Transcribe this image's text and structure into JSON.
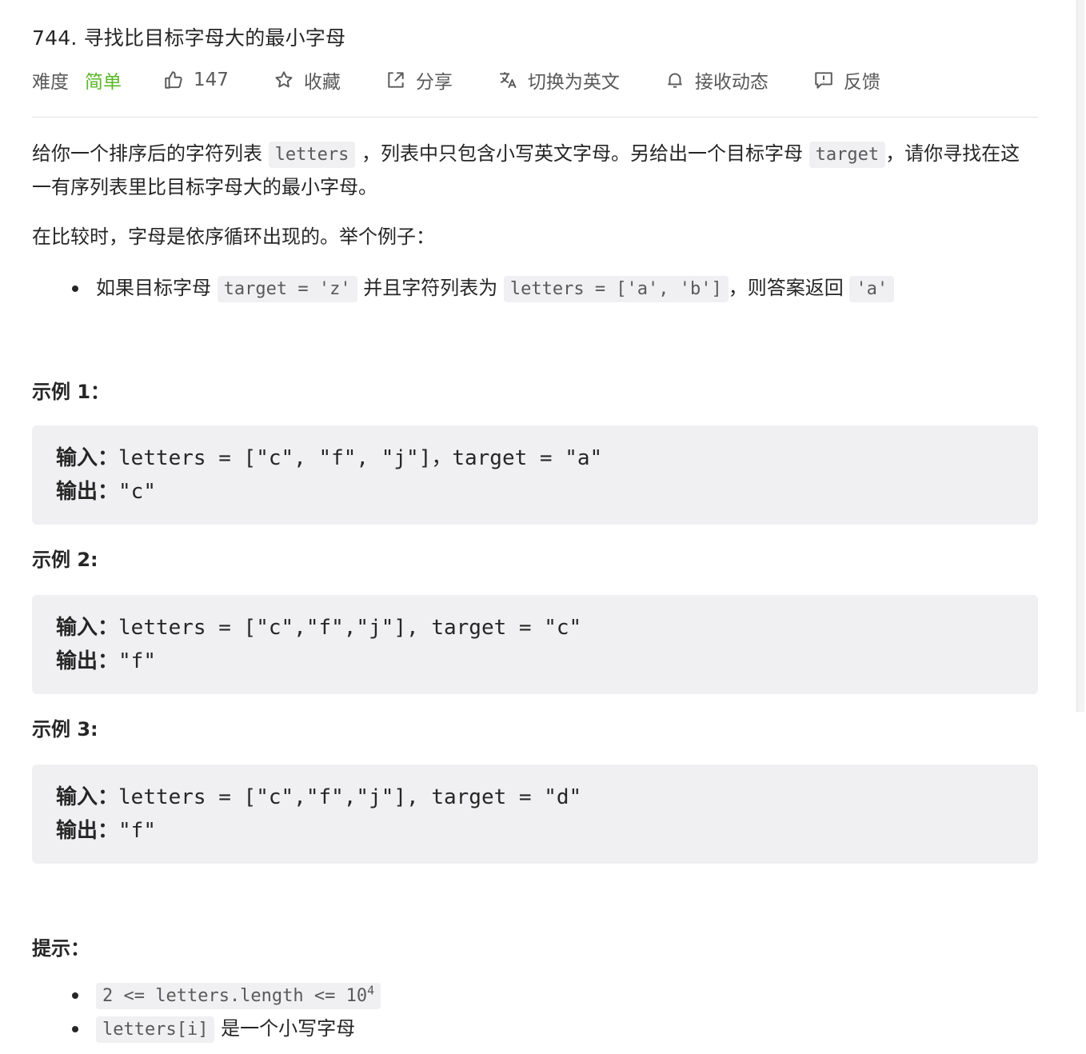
{
  "problem": {
    "title": "744. 寻找比目标字母大的最小字母",
    "difficulty_label": "难度",
    "difficulty_value": "简单",
    "likes": "147",
    "favorite": "收藏",
    "share": "分享",
    "switch_lang": "切换为英文",
    "subscribe": "接收动态",
    "feedback": "反馈"
  },
  "description": {
    "p1_a": "给你一个排序后的字符列表 ",
    "p1_code1": "letters",
    "p1_b": " ，列表中只包含小写英文字母。另给出一个目标字母 ",
    "p1_code2": "target",
    "p1_c": "，请你寻找在这一有序列表里比目标字母大的最小字母。",
    "p2": "在比较时，字母是依序循环出现的。举个例子：",
    "bullet_a": "如果目标字母 ",
    "bullet_code1": "target = 'z'",
    "bullet_b": " 并且字符列表为 ",
    "bullet_code2": "letters = ['a', 'b']",
    "bullet_c": "，则答案返回 ",
    "bullet_code3": "'a'"
  },
  "examples": [
    {
      "title": "示例 1：",
      "in_label": "输入：",
      "input": "letters = [\"c\", \"f\", \"j\"]，target = \"a\"",
      "out_label": "输出：",
      "output": "\"c\""
    },
    {
      "title": "示例 2:",
      "in_label": "输入：",
      "input": "letters = [\"c\",\"f\",\"j\"], target = \"c\"",
      "out_label": "输出：",
      "output": "\"f\""
    },
    {
      "title": "示例 3:",
      "in_label": "输入：",
      "input": "letters = [\"c\",\"f\",\"j\"], target = \"d\"",
      "out_label": "输出：",
      "output": "\"f\""
    }
  ],
  "hints": {
    "title": "提示：",
    "h1_code": "2 <= letters.length <= 10",
    "h1_sup": "4",
    "h2_code": "letters[i]",
    "h2_text": " 是一个小写字母"
  }
}
